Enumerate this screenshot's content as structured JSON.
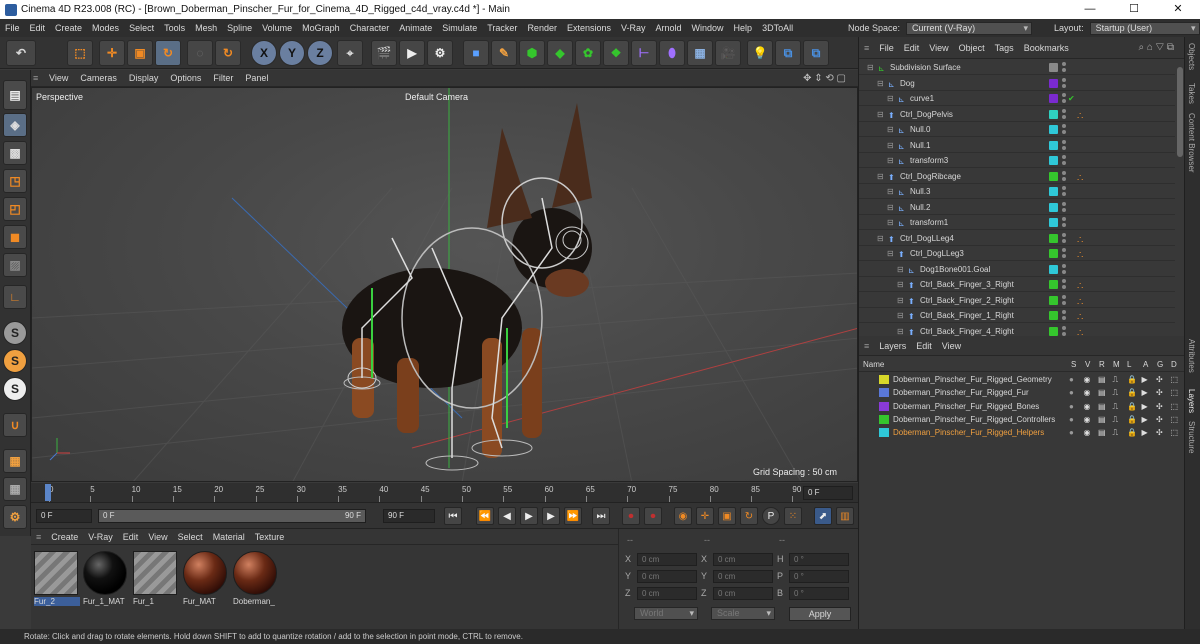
{
  "window": {
    "title": "Cinema 4D R23.008 (RC) - [Brown_Doberman_Pinscher_Fur_for_Cinema_4D_Rigged_c4d_vray.c4d *] - Main",
    "minimize": "—",
    "maximize": "☐",
    "close": "✕"
  },
  "menu": [
    "File",
    "Edit",
    "Create",
    "Modes",
    "Select",
    "Tools",
    "Mesh",
    "Spline",
    "Volume",
    "MoGraph",
    "Character",
    "Animate",
    "Simulate",
    "Tracker",
    "Render",
    "Extensions",
    "V-Ray",
    "Arnold",
    "Window",
    "Help",
    "3DToAll"
  ],
  "node_space": {
    "label": "Node Space:",
    "value": "Current (V-Ray)"
  },
  "layout": {
    "label": "Layout:",
    "value": "Startup (User)"
  },
  "toolbar": {
    "axis_x": "X",
    "axis_y": "Y",
    "axis_z": "Z"
  },
  "viewport": {
    "menu": [
      "View",
      "Cameras",
      "Display",
      "Options",
      "Filter",
      "Panel"
    ],
    "name": "Perspective",
    "camera": "Default Camera",
    "grid_spacing": "Grid Spacing : 50 cm"
  },
  "timeline": {
    "ticks": [
      "0",
      "5",
      "10",
      "15",
      "20",
      "25",
      "30",
      "35",
      "40",
      "45",
      "50",
      "55",
      "60",
      "65",
      "70",
      "75",
      "80",
      "85",
      "90"
    ],
    "current_frame": "0 F",
    "start": "0 F",
    "range_start": "0 F",
    "range_end": "90 F",
    "end": "90 F"
  },
  "materials": {
    "menu": [
      "Create",
      "V-Ray",
      "Edit",
      "View",
      "Select",
      "Material",
      "Texture"
    ],
    "items": [
      {
        "name": "Fur_2",
        "kind": "stripe"
      },
      {
        "name": "Fur_1_MAT",
        "kind": "black"
      },
      {
        "name": "Fur_1",
        "kind": "stripe"
      },
      {
        "name": "Fur_MAT",
        "kind": "brown"
      },
      {
        "name": "Doberman_",
        "kind": "brown"
      }
    ]
  },
  "attributes": {
    "dashes": "--",
    "rows": [
      {
        "a": "X",
        "av": "0 cm",
        "b": "X",
        "bv": "0 cm",
        "c": "H",
        "cv": "0 °"
      },
      {
        "a": "Y",
        "av": "0 cm",
        "b": "Y",
        "bv": "0 cm",
        "c": "P",
        "cv": "0 °"
      },
      {
        "a": "Z",
        "av": "0 cm",
        "b": "Z",
        "bv": "0 cm",
        "c": "B",
        "cv": "0 °"
      }
    ],
    "coord": "World",
    "mode": "Scale",
    "apply": "Apply"
  },
  "objects": {
    "menu": [
      "File",
      "Edit",
      "View",
      "Object",
      "Tags",
      "Bookmarks"
    ],
    "rows": [
      {
        "name": "Subdivision Surface",
        "indent": 0,
        "color": "#8a8a8a",
        "check": "",
        "tag": ""
      },
      {
        "name": "Dog",
        "indent": 1,
        "color": "#7a2ad0",
        "check": "",
        "tag": ""
      },
      {
        "name": "curve1",
        "indent": 2,
        "color": "#7a2ad0",
        "check": "✔",
        "tag": ""
      },
      {
        "name": "Ctrl_DogPelvis",
        "indent": 1,
        "color": "#2fd0c0",
        "check": "",
        "tag": "∴"
      },
      {
        "name": "Null.0",
        "indent": 2,
        "color": "#2fc8d8",
        "check": "",
        "tag": ""
      },
      {
        "name": "Null.1",
        "indent": 2,
        "color": "#2fc8d8",
        "check": "",
        "tag": ""
      },
      {
        "name": "transform3",
        "indent": 2,
        "color": "#2fc8d8",
        "check": "",
        "tag": ""
      },
      {
        "name": "Ctrl_DogRibcage",
        "indent": 1,
        "color": "#35c62d",
        "check": "",
        "tag": "∴"
      },
      {
        "name": "Null.3",
        "indent": 2,
        "color": "#2fc8d8",
        "check": "",
        "tag": ""
      },
      {
        "name": "Null.2",
        "indent": 2,
        "color": "#2fc8d8",
        "check": "",
        "tag": ""
      },
      {
        "name": "transform1",
        "indent": 2,
        "color": "#2fc8d8",
        "check": "",
        "tag": ""
      },
      {
        "name": "Ctrl_DogLLeg4",
        "indent": 1,
        "color": "#35c62d",
        "check": "",
        "tag": "∴"
      },
      {
        "name": "Ctrl_DogLLeg3",
        "indent": 2,
        "color": "#35c62d",
        "check": "",
        "tag": "∴"
      },
      {
        "name": "Dog1Bone001.Goal",
        "indent": 3,
        "color": "#2fc8d8",
        "check": "",
        "tag": ""
      },
      {
        "name": "Ctrl_Back_Finger_3_Right",
        "indent": 3,
        "color": "#35c62d",
        "check": "",
        "tag": "∴"
      },
      {
        "name": "Ctrl_Back_Finger_2_Right",
        "indent": 3,
        "color": "#35c62d",
        "check": "",
        "tag": "∴"
      },
      {
        "name": "Ctrl_Back_Finger_1_Right",
        "indent": 3,
        "color": "#35c62d",
        "check": "",
        "tag": "∴"
      },
      {
        "name": "Ctrl_Back_Finger_4_Right",
        "indent": 3,
        "color": "#35c62d",
        "check": "",
        "tag": "∴"
      }
    ]
  },
  "layers": {
    "menu": [
      "Layers",
      "Edit",
      "View"
    ],
    "columns": [
      "Name",
      "S",
      "V",
      "R",
      "M",
      "L",
      "A",
      "G",
      "D"
    ],
    "items": [
      {
        "name": "Doberman_Pinscher_Fur_Rigged_Geometry",
        "color": "#d8d82a",
        "highlight": false
      },
      {
        "name": "Doberman_Pinscher_Fur_Rigged_Fur",
        "color": "#5a78d8",
        "highlight": false
      },
      {
        "name": "Doberman_Pinscher_Fur_Rigged_Bones",
        "color": "#8a3ad8",
        "highlight": false
      },
      {
        "name": "Doberman_Pinscher_Fur_Rigged_Controllers",
        "color": "#35c62d",
        "highlight": false
      },
      {
        "name": "Doberman_Pinscher_Fur_Rigged_Helpers",
        "color": "#2fc8d8",
        "highlight": true
      }
    ]
  },
  "side_tabs": [
    "Objects",
    "Takes",
    "Content Browser",
    "Attributes",
    "Layers",
    "Structure"
  ],
  "status": "Rotate: Click and drag to rotate elements. Hold down SHIFT to add to quantize rotation / add to the selection in point mode, CTRL to remove.",
  "colors": {
    "accent_orange": "#f08a24",
    "highlight_text": "#f0a040",
    "green_ctrl": "#35c62d"
  }
}
